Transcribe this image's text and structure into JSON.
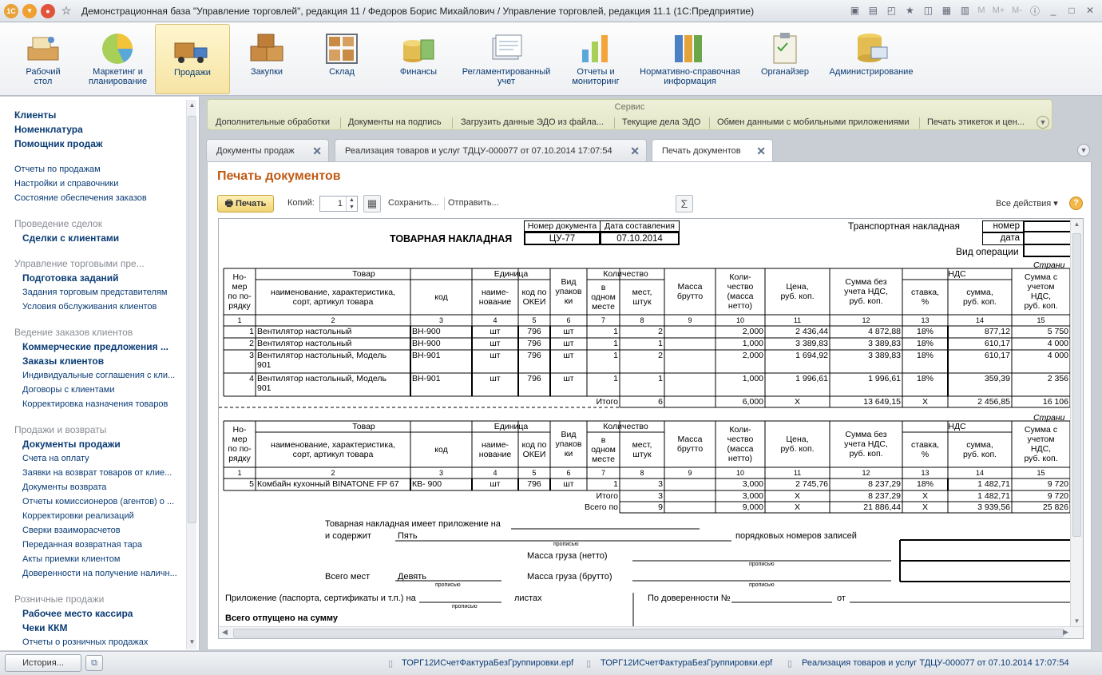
{
  "window": {
    "title": "Демонстрационная база \"Управление торговлей\", редакция 11 / Федоров Борис Михайлович / Управление торговлей, редакция 11.1  (1С:Предприятие)",
    "m_buttons": [
      "M",
      "M+",
      "M-"
    ]
  },
  "sections": [
    {
      "label1": "Рабочий",
      "label2": "стол",
      "icon": "desktop-icon"
    },
    {
      "label1": "Маркетинг и",
      "label2": "планирование",
      "icon": "pie-chart-icon"
    },
    {
      "label1": "Продажи",
      "label2": "",
      "icon": "delivery-truck-icon"
    },
    {
      "label1": "Закупки",
      "label2": "",
      "icon": "boxes-icon"
    },
    {
      "label1": "Склад",
      "label2": "",
      "icon": "warehouse-shelf-icon"
    },
    {
      "label1": "Финансы",
      "label2": "",
      "icon": "coins-icon"
    },
    {
      "label1": "Регламентированный",
      "label2": "учет",
      "icon": "document-stack-icon"
    },
    {
      "label1": "Отчеты и",
      "label2": "мониторинг",
      "icon": "bar-chart-icon"
    },
    {
      "label1": "Нормативно-справочная",
      "label2": "информация",
      "icon": "binders-icon"
    },
    {
      "label1": "Органайзер",
      "label2": "",
      "icon": "clipboard-icon"
    },
    {
      "label1": "Администрирование",
      "label2": "",
      "icon": "database-icon"
    }
  ],
  "sidebar": {
    "top_links": [
      "Клиенты",
      "Номенклатура",
      "Помощник продаж"
    ],
    "plain_links": [
      "Отчеты по продажам",
      "Настройки и справочники",
      "Состояние обеспечения заказов"
    ],
    "groups": [
      {
        "header": "Проведение сделок",
        "items": [
          {
            "t": "Сделки с клиентами",
            "b": true
          }
        ]
      },
      {
        "header": "Управление торговыми пре...",
        "items": [
          {
            "t": "Подготовка заданий",
            "b": true
          },
          {
            "t": "Задания торговым представителям",
            "b": false
          },
          {
            "t": "Условия обслуживания клиентов",
            "b": false
          }
        ]
      },
      {
        "header": "Ведение заказов клиентов",
        "items": [
          {
            "t": "Коммерческие предложения ...",
            "b": true
          },
          {
            "t": "Заказы клиентов",
            "b": true
          },
          {
            "t": "Индивидуальные соглашения с кли...",
            "b": false
          },
          {
            "t": "Договоры с клиентами",
            "b": false
          },
          {
            "t": "Корректировка назначения товаров",
            "b": false
          }
        ]
      },
      {
        "header": "Продажи и возвраты",
        "items": [
          {
            "t": "Документы продажи",
            "b": true
          },
          {
            "t": "Счета на оплату",
            "b": false
          },
          {
            "t": "Заявки на возврат товаров от клие...",
            "b": false
          },
          {
            "t": "Документы возврата",
            "b": false
          },
          {
            "t": "Отчеты комиссионеров (агентов) о ...",
            "b": false
          },
          {
            "t": "Корректировки реализаций",
            "b": false
          },
          {
            "t": "Сверки взаиморасчетов",
            "b": false
          },
          {
            "t": "Переданная возвратная тара",
            "b": false
          },
          {
            "t": "Акты приемки клиентом",
            "b": false
          },
          {
            "t": "Доверенности на получение наличн...",
            "b": false
          }
        ]
      },
      {
        "header": "Розничные продажи",
        "items": [
          {
            "t": "Рабочее место кассира",
            "b": true
          },
          {
            "t": "Чеки ККМ",
            "b": true
          },
          {
            "t": "Отчеты о розничных продажах",
            "b": false
          }
        ]
      }
    ]
  },
  "service": {
    "caption": "Сервис",
    "links": [
      "Дополнительные обработки",
      "Документы на подпись",
      "Загрузить данные ЭДО из файла...",
      "Текущие дела ЭДО",
      "Обмен данными с мобильными приложениями",
      "Печать этикеток и цен..."
    ]
  },
  "tabs": [
    "Документы продаж",
    "Реализация товаров и услуг ТДЦУ-000077 от 07.10.2014 17:07:54",
    "Печать документов"
  ],
  "page": {
    "title": "Печать документов",
    "print_label": "Печать",
    "copies_label": "Копий:",
    "copies_value": "1",
    "save_label": "Сохранить...",
    "send_label": "Отправить...",
    "sum_label": "Σ",
    "all_actions_label": "Все действия",
    "help_label": "?"
  },
  "document": {
    "doc_title": "ТОВАРНАЯ НАКЛАДНАЯ",
    "num_header": "Номер документа",
    "date_header": "Дата составления",
    "doc_number": "ЦУ-77",
    "doc_date": "07.10.2014",
    "transport": "Транспортная накладная",
    "nomer": "номер",
    "data": "дата",
    "vid_operacii": "Вид операции",
    "page_word": "Страни",
    "headers": {
      "num": [
        "Но-",
        "мер",
        "по по-",
        "рядку"
      ],
      "tovar": "Товар",
      "tovar_name": [
        "наименование, характеристика,",
        "сорт, артикул товара"
      ],
      "kod": "код",
      "unit": "Единица измерения",
      "unit_name": [
        "наиме-",
        "нование"
      ],
      "okei": [
        "код по",
        "ОКЕИ"
      ],
      "vid": [
        "Вид",
        "упаков",
        "ки"
      ],
      "qty": "Количество",
      "in_one": [
        "в",
        "одном",
        "месте"
      ],
      "places": [
        "мест,",
        "штук"
      ],
      "mass_b": [
        "Масса",
        "брутто"
      ],
      "qty_net": [
        "Коли-",
        "чество",
        "(масса",
        "нетто)"
      ],
      "price": [
        "Цена,",
        "руб. коп."
      ],
      "sum_no_vat": [
        "Сумма без",
        "учета НДС,",
        "руб. коп."
      ],
      "nds": "НДС",
      "rate": [
        "ставка,",
        "%"
      ],
      "nds_sum": [
        "сумма,",
        "руб. коп."
      ],
      "sum_vat": [
        "Сумма с",
        "учетом",
        "НДС,",
        "руб. коп."
      ],
      "colnums": [
        "1",
        "2",
        "3",
        "4",
        "5",
        "6",
        "7",
        "8",
        "9",
        "10",
        "11",
        "12",
        "13",
        "14",
        "15"
      ]
    },
    "rows1": [
      {
        "n": "1",
        "name": [
          "Вентилятор настольный"
        ],
        "code": "ВН-900",
        "unit": "шт",
        "okei": "796",
        "pack": "шт",
        "one": "1",
        "places": "2",
        "net": "2,000",
        "price": "2 436,44",
        "sum": "4 872,88",
        "rate": "18%",
        "nds": "877,12",
        "total": "5 750"
      },
      {
        "n": "2",
        "name": [
          "Вентилятор настольный"
        ],
        "code": "ВН-900",
        "unit": "шт",
        "okei": "796",
        "pack": "шт",
        "one": "1",
        "places": "1",
        "net": "1,000",
        "price": "3 389,83",
        "sum": "3 389,83",
        "rate": "18%",
        "nds": "610,17",
        "total": "4 000"
      },
      {
        "n": "3",
        "name": [
          "Вентилятор настольный, Модель",
          "901"
        ],
        "code": "ВН-901",
        "unit": "шт",
        "okei": "796",
        "pack": "шт",
        "one": "1",
        "places": "2",
        "net": "2,000",
        "price": "1 694,92",
        "sum": "3 389,83",
        "rate": "18%",
        "nds": "610,17",
        "total": "4 000"
      },
      {
        "n": "4",
        "name": [
          "Вентилятор настольный, Модель",
          "901"
        ],
        "code": "ВН-901",
        "unit": "шт",
        "okei": "796",
        "pack": "шт",
        "one": "1",
        "places": "1",
        "net": "1,000",
        "price": "1 996,61",
        "sum": "1 996,61",
        "rate": "18%",
        "nds": "359,39",
        "total": "2 356"
      }
    ],
    "itogo1": {
      "label": "Итого",
      "places": "6",
      "net": "6,000",
      "price": "X",
      "sum": "13 649,15",
      "rate": "X",
      "nds": "2 456,85",
      "total": "16 106"
    },
    "rows2": [
      {
        "n": "5",
        "name": [
          "Комбайн кухонный BINATONE FP 67"
        ],
        "code": "КВ- 900",
        "unit": "шт",
        "okei": "796",
        "pack": "шт",
        "one": "1",
        "places": "3",
        "net": "3,000",
        "price": "2 745,76",
        "sum": "8 237,29",
        "rate": "18%",
        "nds": "1 482,71",
        "total": "9 720"
      }
    ],
    "itogo2": {
      "label": "Итого",
      "places": "3",
      "net": "3,000",
      "price": "X",
      "sum": "8 237,29",
      "rate": "X",
      "nds": "1 482,71",
      "total": "9 720"
    },
    "vsego": {
      "label": "Всего по накладной",
      "places": "9",
      "net": "9,000",
      "price": "X",
      "sum": "21 886,44",
      "rate": "X",
      "nds": "3 939,56",
      "total": "25 826"
    },
    "footer": {
      "attach": "Товарная накладная имеет приложение на",
      "contains": "и содержит",
      "contains_value": "Пять",
      "propisyu": "прописью",
      "records": "порядковых номеров записей",
      "mass_net": "Масса груза (нетто)",
      "mass_brut": "Масса груза (брутто)",
      "places_total": "Всего мест",
      "places_value": "Девять",
      "appendix": "Приложение (паспорта, сертификаты и т.п.) на",
      "sheets": "листах",
      "proxy": "По доверенности №",
      "from": "от",
      "released": "Всего отпущено  на сумму"
    }
  },
  "status": {
    "history_label": "История...",
    "links": [
      "ТОРГ12ИСчетФактураБезГруппировки.epf",
      "ТОРГ12ИСчетФактураБезГруппировки.epf",
      "Реализация товаров и услуг ТДЦУ-000077 от 07.10.2014 17:07:54"
    ]
  }
}
